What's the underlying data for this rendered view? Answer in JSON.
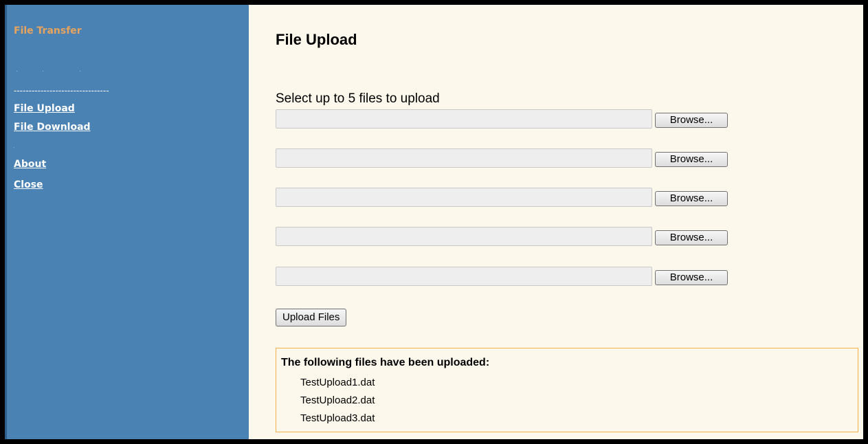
{
  "sidebar": {
    "brand": "File Transfer",
    "separator": "--------------------------------",
    "nav": [
      {
        "label": "File Upload"
      },
      {
        "label": "File Download"
      },
      {
        "label": "About"
      },
      {
        "label": "Close"
      }
    ]
  },
  "main": {
    "title": "File Upload",
    "instructions": "Select up to 5 files to upload",
    "file_inputs": [
      {
        "value": "",
        "browse_label": "Browse..."
      },
      {
        "value": "",
        "browse_label": "Browse..."
      },
      {
        "value": "",
        "browse_label": "Browse..."
      },
      {
        "value": "",
        "browse_label": "Browse..."
      },
      {
        "value": "",
        "browse_label": "Browse..."
      }
    ],
    "upload_label": "Upload Files",
    "results": {
      "title": "The following files have been uploaded:",
      "files": [
        "TestUpload1.dat",
        "TestUpload2.dat",
        "TestUpload3.dat"
      ]
    }
  },
  "colors": {
    "sidebar_bg": "#4a82b4",
    "brand": "#e8a35c",
    "main_bg": "#fdf8ec",
    "results_border": "#f5b04a"
  }
}
